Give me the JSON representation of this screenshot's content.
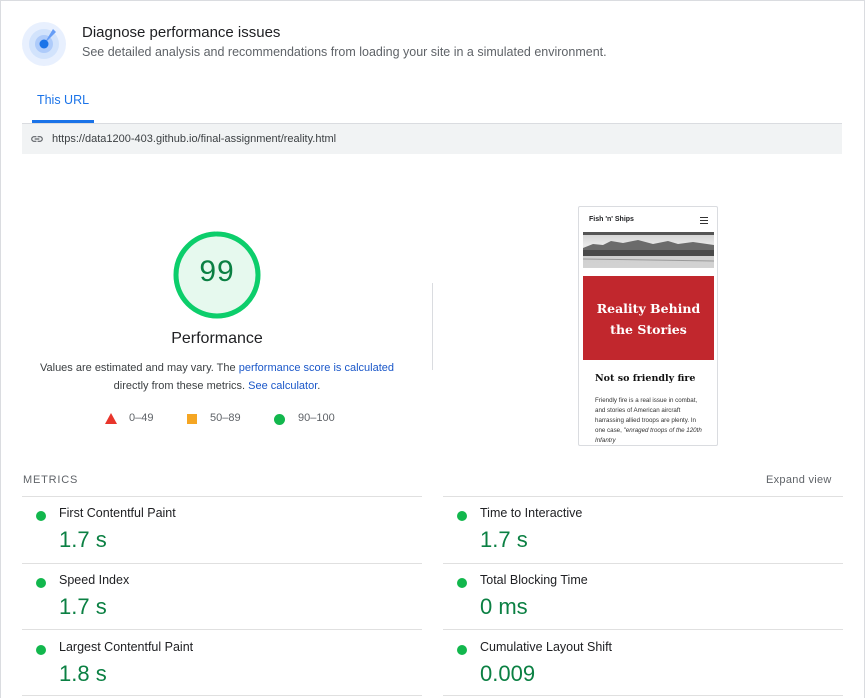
{
  "header": {
    "title": "Diagnose performance issues",
    "subtitle": "See detailed analysis and recommendations from loading your site in a simulated environment."
  },
  "tabs": [
    {
      "label": "This URL",
      "active": true
    }
  ],
  "url": "https://data1200-403.github.io/final-assignment/reality.html",
  "score": {
    "value": "99",
    "fraction": 0.99,
    "label": "Performance",
    "color": "#0cce6b"
  },
  "note": {
    "part1": "Values are estimated and may vary. The ",
    "link1": "performance score is calculated",
    "part2": " directly from these metrics. ",
    "link2": "See calculator",
    "part3": "."
  },
  "legend": [
    {
      "range": "0–49",
      "shape": "triangle",
      "color": "#e8352b"
    },
    {
      "range": "50–89",
      "shape": "square",
      "color": "#f5a623"
    },
    {
      "range": "90–100",
      "shape": "circle",
      "color": "#12b74d"
    }
  ],
  "preview": {
    "brand": "Fish 'n' Ships",
    "hero_line1": "Reality Behind",
    "hero_line2": "the Stories",
    "heading": "Not so friendly fire",
    "body": "Friendly fire is a real issue in combat, and stories of American aircraft harrassing allied troops are plenty. In one case, ",
    "body_italic": "\"enraged troops of the 120th Infantry"
  },
  "metrics": {
    "title": "METRICS",
    "expand_label": "Expand view",
    "items": [
      {
        "name": "First Contentful Paint",
        "value": "1.7 s"
      },
      {
        "name": "Time to Interactive",
        "value": "1.7 s"
      },
      {
        "name": "Speed Index",
        "value": "1.7 s"
      },
      {
        "name": "Total Blocking Time",
        "value": "0 ms"
      },
      {
        "name": "Largest Contentful Paint",
        "value": "1.8 s"
      },
      {
        "name": "Cumulative Layout Shift",
        "value": "0.009"
      }
    ]
  }
}
